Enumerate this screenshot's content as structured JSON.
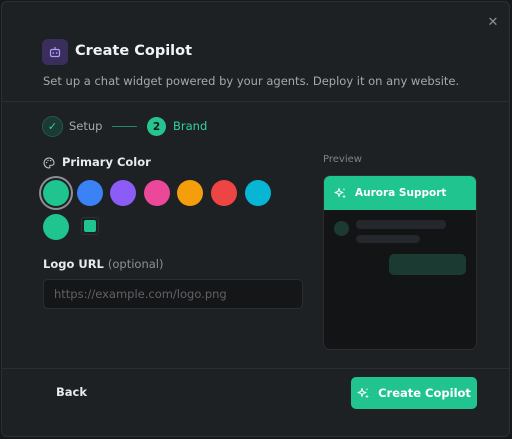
{
  "dialog": {
    "title": "Create Copilot",
    "subtitle": "Set up a chat widget powered by your agents. Deploy it on any website.",
    "close_icon": "close-icon",
    "header_icon": "bot-icon"
  },
  "steps": [
    {
      "label": "Setup",
      "state": "done",
      "marker": "✓"
    },
    {
      "label": "Brand",
      "state": "current",
      "marker": "2"
    }
  ],
  "primary_color": {
    "label": "Primary Color",
    "icon": "palette-icon",
    "swatches": [
      {
        "name": "green",
        "color": "#1fc48e",
        "selected": true
      },
      {
        "name": "blue",
        "color": "#3b82f6",
        "selected": false
      },
      {
        "name": "purple",
        "color": "#8b5cf6",
        "selected": false
      },
      {
        "name": "pink",
        "color": "#ec4899",
        "selected": false
      },
      {
        "name": "orange",
        "color": "#f59e0b",
        "selected": false
      },
      {
        "name": "red",
        "color": "#ef4444",
        "selected": false
      },
      {
        "name": "cyan",
        "color": "#06b6d4",
        "selected": false
      },
      {
        "name": "green-2",
        "color": "#1fc48e",
        "selected": false
      }
    ],
    "custom_color": "#1fc48e"
  },
  "logo": {
    "label": "Logo URL",
    "optional": "(optional)",
    "value": "",
    "placeholder": "https://example.com/logo.png"
  },
  "preview": {
    "label": "Preview",
    "header_title": "Aurora Support",
    "header_icon": "sparkles-icon"
  },
  "footer": {
    "back_label": "Back",
    "create_label": "Create Copilot",
    "create_icon": "sparkles-icon"
  }
}
